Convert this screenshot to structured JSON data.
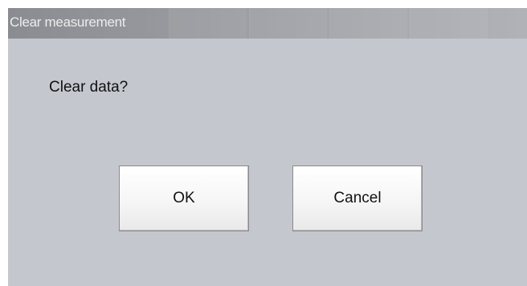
{
  "dialog": {
    "title": "Clear measurement",
    "message": "Clear data?",
    "buttons": {
      "ok_label": "OK",
      "cancel_label": "Cancel"
    }
  },
  "colors": {
    "dialog_background": "#c5c7cf",
    "titlebar": "#9a9ca1",
    "title_text": "#ececec"
  }
}
